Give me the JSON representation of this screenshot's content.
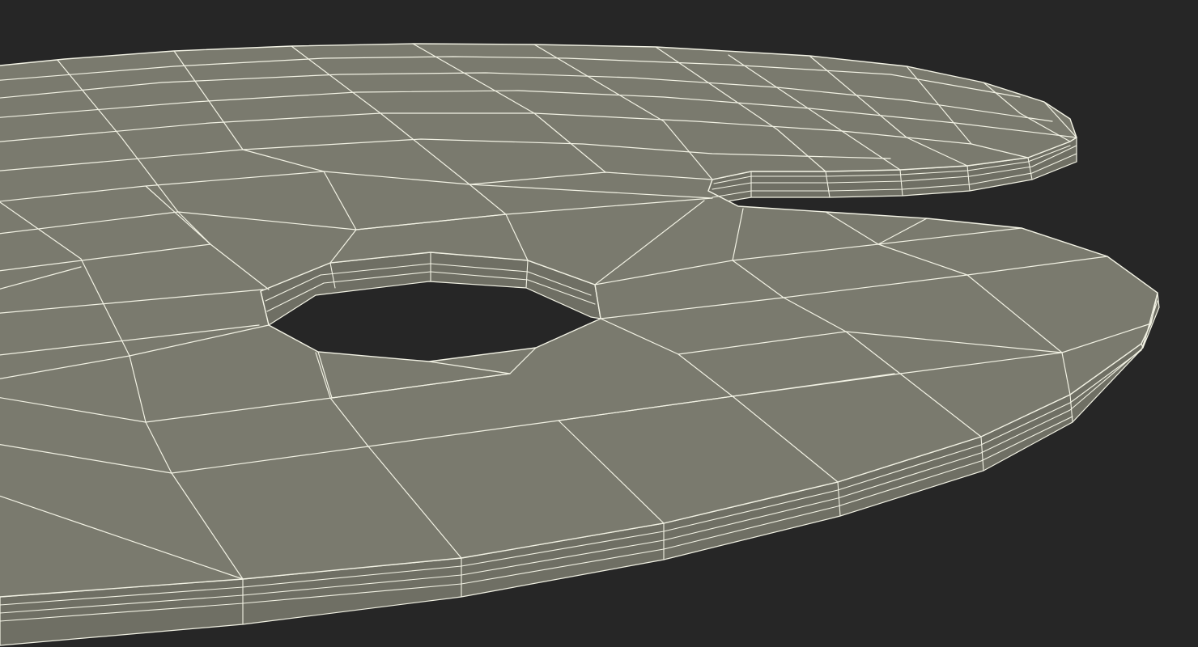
{
  "scene": {
    "subject": "palette-wireframe-render",
    "colors": {
      "background": "#262626",
      "surface": "#7a7a6e",
      "rim": "#6f6f64",
      "wire": "#f2f2e4"
    }
  }
}
